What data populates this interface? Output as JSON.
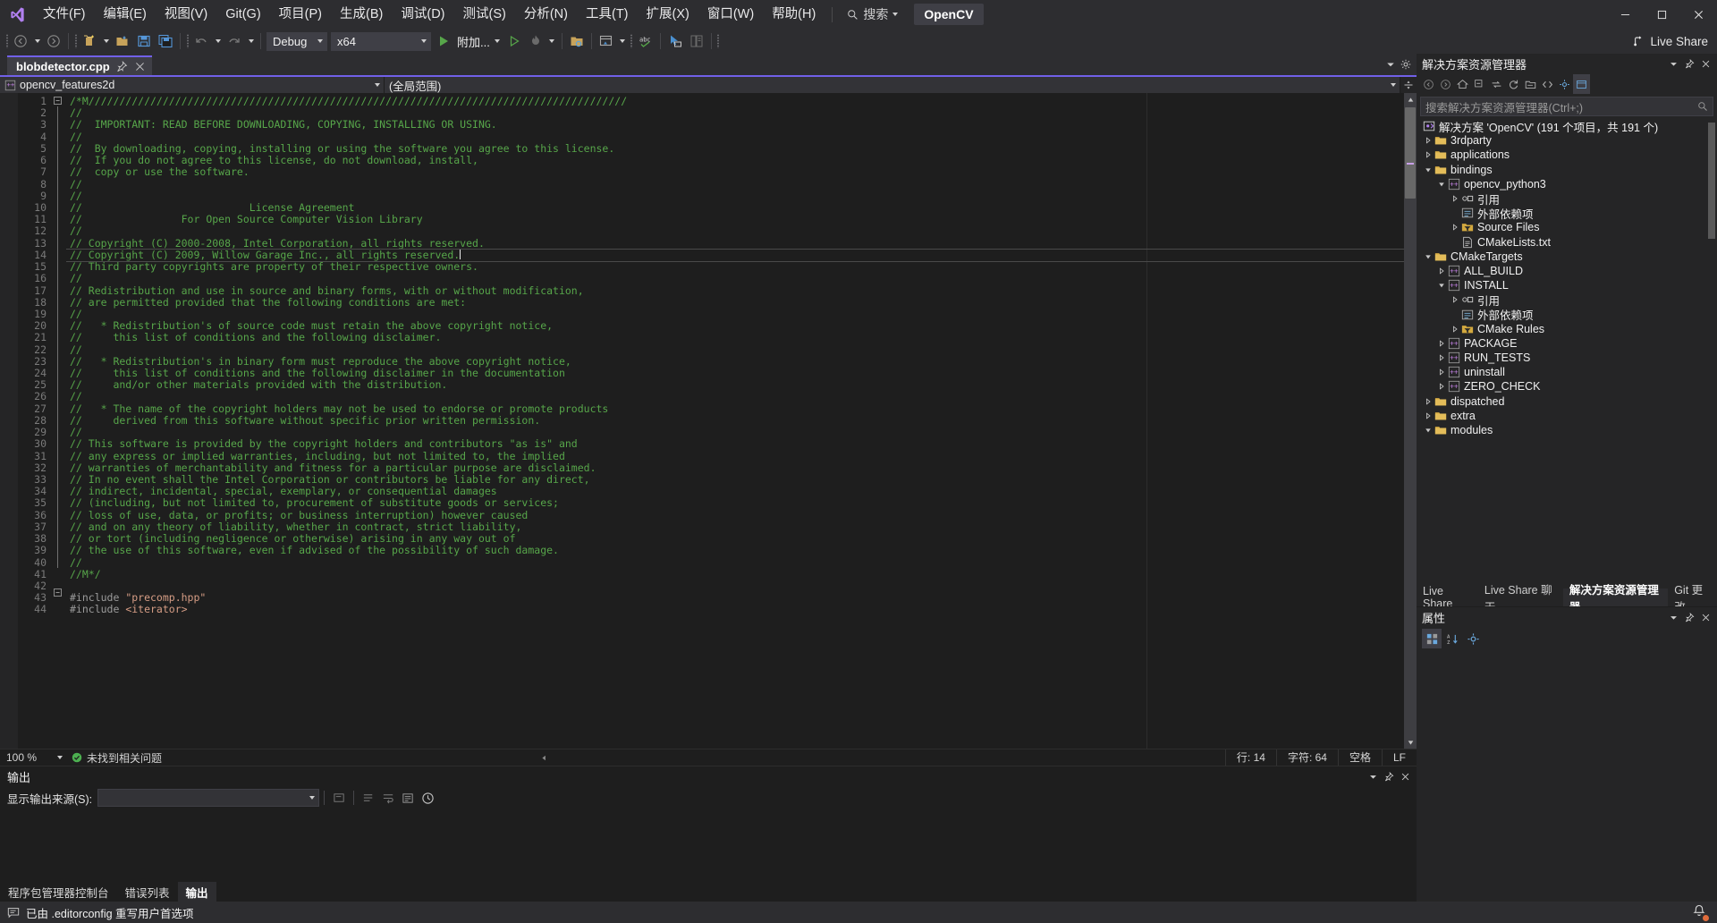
{
  "titlebar": {
    "logo_icon": "visual-studio-logo",
    "menus": [
      {
        "label": "文件(F)"
      },
      {
        "label": "编辑(E)"
      },
      {
        "label": "视图(V)"
      },
      {
        "label": "Git(G)"
      },
      {
        "label": "项目(P)"
      },
      {
        "label": "生成(B)"
      },
      {
        "label": "调试(D)"
      },
      {
        "label": "测试(S)"
      },
      {
        "label": "分析(N)"
      },
      {
        "label": "工具(T)"
      },
      {
        "label": "扩展(X)"
      },
      {
        "label": "窗口(W)"
      },
      {
        "label": "帮助(H)"
      }
    ],
    "search_label": "搜索",
    "solution_chip": "OpenCV",
    "window_buttons": {
      "minimize": "minimize-icon",
      "maximize": "maximize-icon",
      "close": "close-icon"
    }
  },
  "toolbar": {
    "nav_back": "navigate-back-icon",
    "nav_forward": "navigate-forward-icon",
    "new_project": "new-project-icon",
    "open_file": "open-file-icon",
    "save": "save-icon",
    "save_all": "save-all-icon",
    "undo": "undo-icon",
    "redo": "redo-icon",
    "config": "Debug",
    "platform": "x64",
    "run_label": "附加...",
    "live_share": "Live Share"
  },
  "editor": {
    "tab_name": "blobdetector.cpp",
    "tab_pin_icon": "pin-icon",
    "tab_close_icon": "close-icon",
    "nav_left": "opencv_features2d",
    "nav_right": "(全局范围)",
    "first_line": 1,
    "lines": [
      "/*M///////////////////////////////////////////////////////////////////////////////////////",
      "//",
      "//  IMPORTANT: READ BEFORE DOWNLOADING, COPYING, INSTALLING OR USING.",
      "//",
      "//  By downloading, copying, installing or using the software you agree to this license.",
      "//  If you do not agree to this license, do not download, install,",
      "//  copy or use the software.",
      "//",
      "//",
      "//                           License Agreement",
      "//                For Open Source Computer Vision Library",
      "//",
      "// Copyright (C) 2000-2008, Intel Corporation, all rights reserved.",
      "// Copyright (C) 2009, Willow Garage Inc., all rights reserved.",
      "// Third party copyrights are property of their respective owners.",
      "//",
      "// Redistribution and use in source and binary forms, with or without modification,",
      "// are permitted provided that the following conditions are met:",
      "//",
      "//   * Redistribution's of source code must retain the above copyright notice,",
      "//     this list of conditions and the following disclaimer.",
      "//",
      "//   * Redistribution's in binary form must reproduce the above copyright notice,",
      "//     this list of conditions and the following disclaimer in the documentation",
      "//     and/or other materials provided with the distribution.",
      "//",
      "//   * The name of the copyright holders may not be used to endorse or promote products",
      "//     derived from this software without specific prior written permission.",
      "//",
      "// This software is provided by the copyright holders and contributors \"as is\" and",
      "// any express or implied warranties, including, but not limited to, the implied",
      "// warranties of merchantability and fitness for a particular purpose are disclaimed.",
      "// In no event shall the Intel Corporation or contributors be liable for any direct,",
      "// indirect, incidental, special, exemplary, or consequential damages",
      "// (including, but not limited to, procurement of substitute goods or services;",
      "// loss of use, data, or profits; or business interruption) however caused",
      "// and on any theory of liability, whether in contract, strict liability,",
      "// or tort (including negligence or otherwise) arising in any way out of",
      "// the use of this software, even if advised of the possibility of such damage.",
      "//",
      "//M*/",
      "",
      "#include \"precomp.hpp\"",
      "#include <iterator>"
    ],
    "current_line_index": 13,
    "status": {
      "zoom": "100 %",
      "problems": "未找到相关问题",
      "line_label": "行: 14",
      "col_label": "字符: 64",
      "space_label": "空格",
      "eol_label": "LF"
    }
  },
  "output": {
    "title": "输出",
    "source_label": "显示输出来源(S):",
    "source_value": "",
    "icons": {
      "dropdown": "chevron-down-icon",
      "pin": "pin-icon",
      "close": "close-icon",
      "find": "find-icon",
      "clear": "clear-all-icon",
      "wrap": "word-wrap-icon",
      "go_to": "go-to-icon",
      "timestamp": "timestamp-icon"
    },
    "tabs": [
      {
        "label": "程序包管理器控制台",
        "active": false
      },
      {
        "label": "错误列表",
        "active": false
      },
      {
        "label": "输出",
        "active": true
      }
    ]
  },
  "solution_explorer": {
    "title": "解决方案资源管理器",
    "search_placeholder": "搜索解决方案资源管理器(Ctrl+;)",
    "toolbar_icons": [
      "navigate-back-icon",
      "navigate-forward-icon",
      "home-icon",
      "collapse-all-icon",
      "sync-icon",
      "refresh-icon",
      "show-all-files-icon",
      "code-view-icon",
      "properties-icon",
      "solution-view-icon"
    ],
    "root": "解决方案 'OpenCV' (191 个项目，共 191 个)",
    "nodes": [
      {
        "label": "3rdparty",
        "depth": 1,
        "icon": "folder-icon",
        "arrow": "collapsed"
      },
      {
        "label": "applications",
        "depth": 1,
        "icon": "folder-icon",
        "arrow": "collapsed"
      },
      {
        "label": "bindings",
        "depth": 1,
        "icon": "folder-icon",
        "arrow": "expanded"
      },
      {
        "label": "opencv_python3",
        "depth": 2,
        "icon": "cpp-project-icon",
        "arrow": "expanded"
      },
      {
        "label": "引用",
        "depth": 3,
        "icon": "references-icon",
        "arrow": "collapsed"
      },
      {
        "label": "外部依赖项",
        "depth": 3,
        "icon": "external-deps-icon",
        "arrow": "none"
      },
      {
        "label": "Source Files",
        "depth": 3,
        "icon": "filter-folder-icon",
        "arrow": "collapsed"
      },
      {
        "label": "CMakeLists.txt",
        "depth": 3,
        "icon": "text-file-icon",
        "arrow": "none"
      },
      {
        "label": "CMakeTargets",
        "depth": 1,
        "icon": "folder-icon",
        "arrow": "expanded"
      },
      {
        "label": "ALL_BUILD",
        "depth": 2,
        "icon": "cpp-project-icon",
        "arrow": "collapsed"
      },
      {
        "label": "INSTALL",
        "depth": 2,
        "icon": "cpp-project-icon",
        "arrow": "expanded"
      },
      {
        "label": "引用",
        "depth": 3,
        "icon": "references-icon",
        "arrow": "collapsed"
      },
      {
        "label": "外部依赖项",
        "depth": 3,
        "icon": "external-deps-icon",
        "arrow": "none"
      },
      {
        "label": "CMake Rules",
        "depth": 3,
        "icon": "filter-folder-icon",
        "arrow": "collapsed"
      },
      {
        "label": "PACKAGE",
        "depth": 2,
        "icon": "cpp-project-icon",
        "arrow": "collapsed"
      },
      {
        "label": "RUN_TESTS",
        "depth": 2,
        "icon": "cpp-project-icon",
        "arrow": "collapsed"
      },
      {
        "label": "uninstall",
        "depth": 2,
        "icon": "cpp-project-icon",
        "arrow": "collapsed"
      },
      {
        "label": "ZERO_CHECK",
        "depth": 2,
        "icon": "cpp-project-icon",
        "arrow": "collapsed"
      },
      {
        "label": "dispatched",
        "depth": 1,
        "icon": "folder-icon",
        "arrow": "collapsed"
      },
      {
        "label": "extra",
        "depth": 1,
        "icon": "folder-icon",
        "arrow": "collapsed"
      },
      {
        "label": "modules",
        "depth": 1,
        "icon": "folder-icon",
        "arrow": "expanded"
      }
    ],
    "tabs": [
      {
        "label": "Live Share",
        "active": false
      },
      {
        "label": "Live Share 聊天",
        "active": false
      },
      {
        "label": "解决方案资源管理器",
        "active": true
      },
      {
        "label": "Git 更改",
        "active": false
      }
    ]
  },
  "properties": {
    "title": "属性",
    "toolbar_icons": [
      "categorized-icon",
      "alphabetical-icon",
      "properties-page-icon"
    ]
  },
  "statusbar": {
    "message": "已由 .editorconfig 重写用户首选项",
    "message_icon": "editorconfig-icon",
    "notification_icon": "bell-icon"
  },
  "colors": {
    "accent": "#7160e8",
    "comment_green": "#57a64a",
    "chrome": "#2d2d30",
    "editor_bg": "#1e1e1e",
    "panel_bg": "#252526"
  }
}
